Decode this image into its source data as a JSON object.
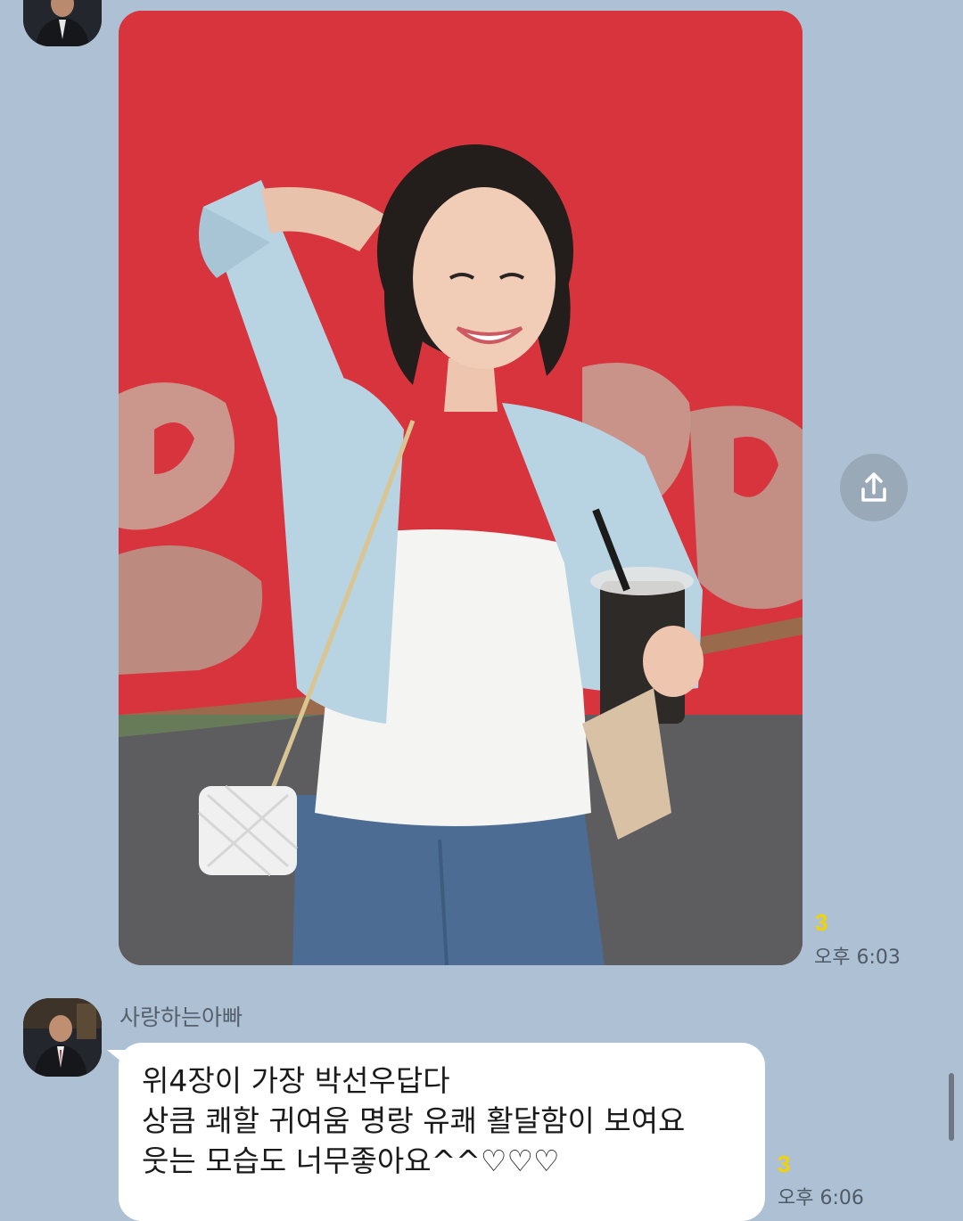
{
  "theme": {
    "background": "#aec1d4",
    "bubble": "#ffffff",
    "unread_color": "#f2d200"
  },
  "messages": [
    {
      "type": "photo",
      "avatar_icon": "profile-photo",
      "unread_count": "3",
      "time": "오후 6:03",
      "share_icon": "share-icon"
    },
    {
      "type": "text",
      "sender": "사랑하는아빠",
      "avatar_icon": "profile-photo",
      "lines": [
        "위4장이 가장 박선우답다",
        "상큼 쾌할 귀여움 명랑 유쾌 활달함이 보여요",
        "웃는 모습도 너무좋아요^^♡♡♡"
      ],
      "unread_count": "3",
      "time": "오후 6:06"
    }
  ]
}
